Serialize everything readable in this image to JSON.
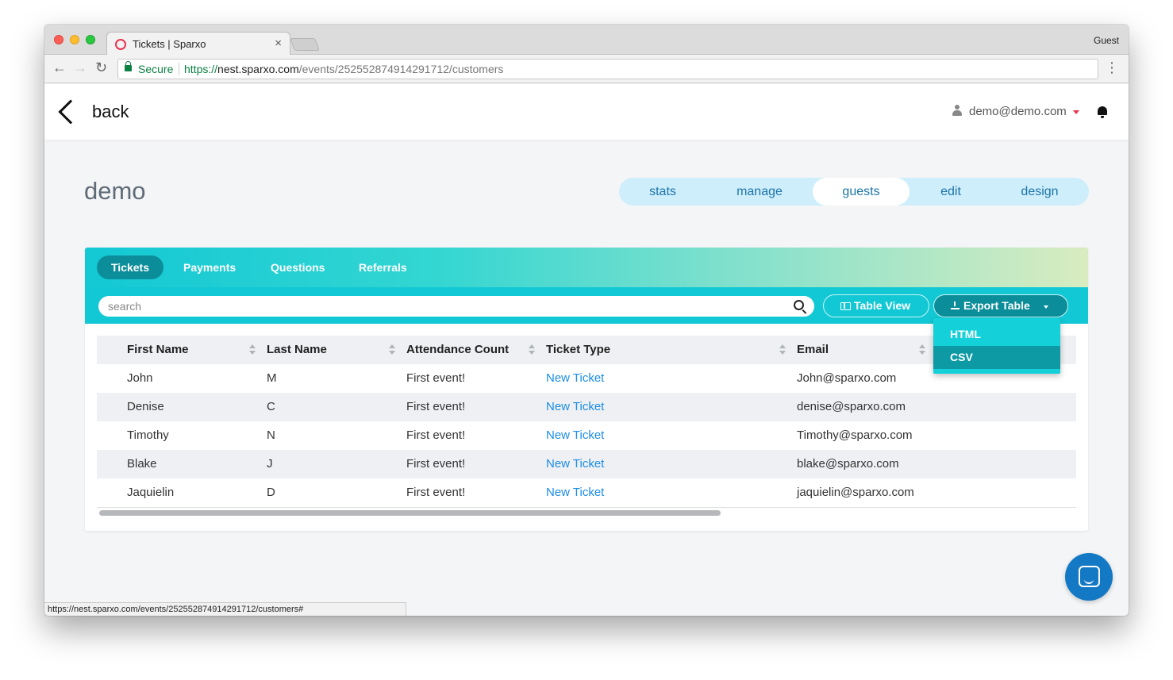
{
  "browser": {
    "tab_title": "Tickets | Sparxo",
    "tab_close": "×",
    "profile": "Guest",
    "secure_label": "Secure",
    "url_scheme": "https://",
    "url_host": "nest.sparxo.com",
    "url_path": "/events/252552874914291712/customers",
    "status_url": "https://nest.sparxo.com/events/252552874914291712/customers#",
    "nav_back": "←",
    "nav_forward": "→",
    "nav_reload": "↻",
    "menu": "⋮"
  },
  "header": {
    "back_label": "back",
    "user_email": "demo@demo.com"
  },
  "event": {
    "title": "demo"
  },
  "event_nav": {
    "items": [
      "stats",
      "manage",
      "guests",
      "edit",
      "design"
    ],
    "active": "guests"
  },
  "subtabs": {
    "items": [
      "Tickets",
      "Payments",
      "Questions",
      "Referrals"
    ],
    "active": "Tickets"
  },
  "search": {
    "placeholder": "search",
    "value": ""
  },
  "toolbar": {
    "table_view_label": "Table View",
    "export_label": "Export Table"
  },
  "export_menu": {
    "items": [
      "HTML",
      "CSV"
    ],
    "highlighted": "CSV"
  },
  "table": {
    "columns": [
      "First Name",
      "Last Name",
      "Attendance Count",
      "Ticket Type",
      "Email"
    ],
    "rows": [
      [
        "John",
        "M",
        "First event!",
        "New Ticket",
        "John@sparxo.com"
      ],
      [
        "Denise",
        "C",
        "First event!",
        "New Ticket",
        "denise@sparxo.com"
      ],
      [
        "Timothy",
        "N",
        "First event!",
        "New Ticket",
        "Timothy@sparxo.com"
      ],
      [
        "Blake",
        "J",
        "First event!",
        "New Ticket",
        "blake@sparxo.com"
      ],
      [
        "Jaquielin",
        "D",
        "First event!",
        "New Ticket",
        "jaquielin@sparxo.com"
      ]
    ]
  },
  "colors": {
    "accent": "#12c8d4",
    "accent_dark": "#0c8e9a",
    "link": "#1a8de6",
    "brand": "#e8344f",
    "nav_bg": "#cfeefb",
    "chat": "#1479c4"
  }
}
